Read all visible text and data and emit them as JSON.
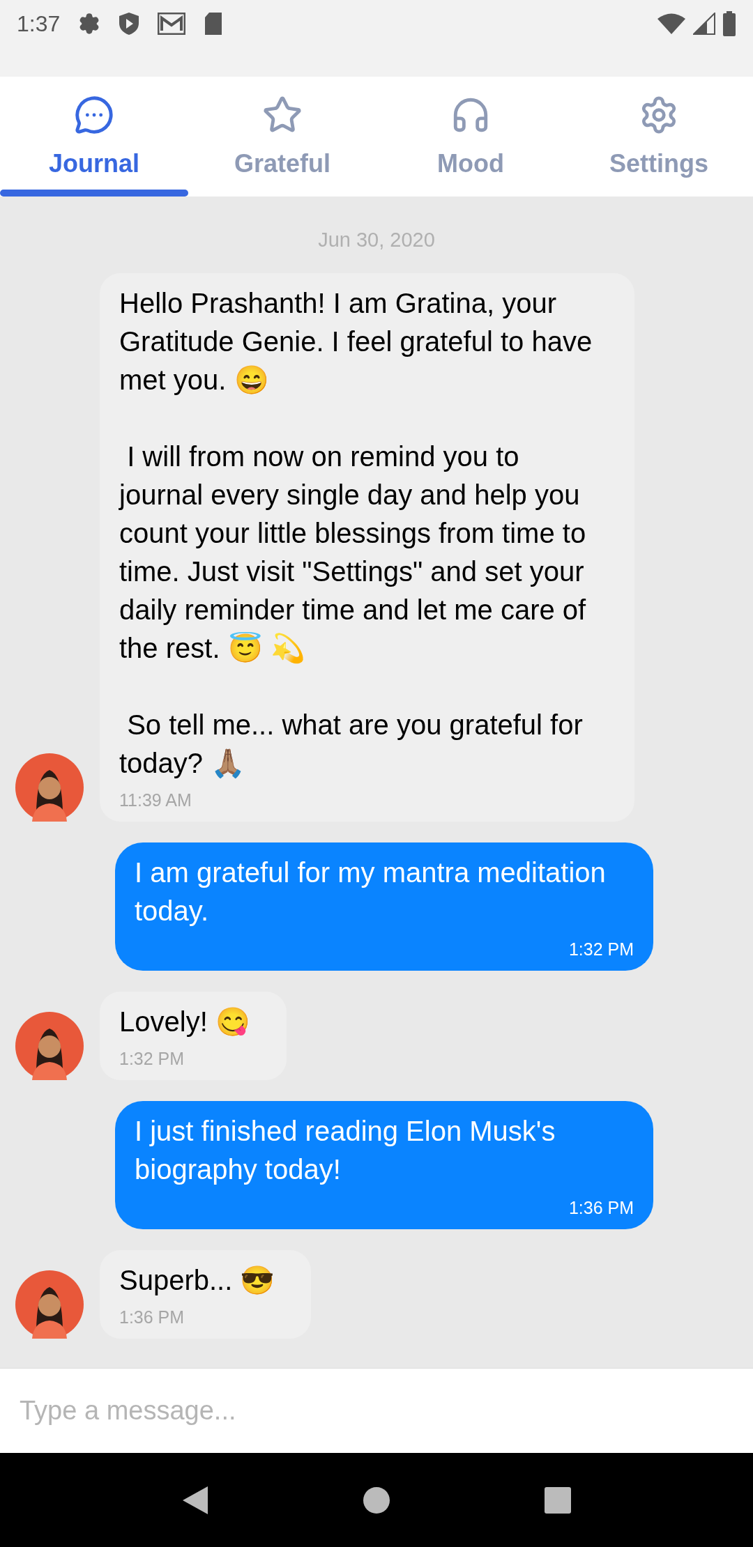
{
  "status_bar": {
    "time": "1:37"
  },
  "tabs": [
    {
      "label": "Journal",
      "selected": true
    },
    {
      "label": "Grateful",
      "selected": false
    },
    {
      "label": "Mood",
      "selected": false
    },
    {
      "label": "Settings",
      "selected": false
    }
  ],
  "chat": {
    "date": "Jun 30, 2020",
    "messages": [
      {
        "kind": "received",
        "text": "Hello Prashanth! I am Gratina, your Gratitude Genie. I feel grateful to have met you. 😄\n\n I will from now on remind you to journal every single day and help you count your little blessings from time to time. Just visit \"Settings\" and set your daily reminder time and let me care of the rest. 😇 💫\n\n So tell me... what are you grateful for today? 🙏🏽",
        "time": "11:39 AM"
      },
      {
        "kind": "sent",
        "text": "I am grateful for my mantra meditation today.",
        "time": "1:32 PM"
      },
      {
        "kind": "received",
        "text": "Lovely! 😋",
        "time": "1:32 PM"
      },
      {
        "kind": "sent",
        "text": "I just finished reading Elon Musk's biography today!",
        "time": "1:36 PM"
      },
      {
        "kind": "received",
        "text": "Superb... 😎",
        "time": "1:36 PM"
      }
    ]
  },
  "composer": {
    "placeholder": "Type a message..."
  }
}
